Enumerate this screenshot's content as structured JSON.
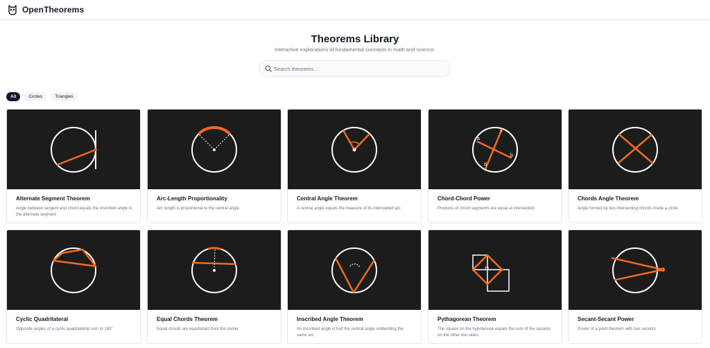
{
  "header": {
    "brand": "OpenTheorems",
    "logo_icon": "owl-icon"
  },
  "page": {
    "title": "Theorems Library",
    "subtitle": "Interactive explorations of fundamental concepts in math and science."
  },
  "search": {
    "placeholder": "Search theorems...",
    "value": ""
  },
  "filters": [
    {
      "label": "All",
      "active": true
    },
    {
      "label": "Circles",
      "active": false
    },
    {
      "label": "Triangles",
      "active": false
    }
  ],
  "colors": {
    "accent": "#f26b1d",
    "thumb_background": "#1c1c1c",
    "active_chip": "#0f172a"
  },
  "cards": [
    {
      "title": "Alternate Segment Theorem",
      "description": "Angle between tangent and chord equals the inscribed angle in the alternate segment"
    },
    {
      "title": "Arc-Length Proportionality",
      "description": "Arc length is proportional to the central angle"
    },
    {
      "title": "Central Angle Theorem",
      "description": "A central angle equals the measure of its intercepted arc"
    },
    {
      "title": "Chord-Chord Power",
      "description": "Products of chord segments are equal at intersection",
      "diagram_labels": [
        "a",
        "b",
        "c",
        "d"
      ]
    },
    {
      "title": "Chords Angle Theorem",
      "description": "Angle formed by two intersecting chords inside a circle"
    },
    {
      "title": "Cyclic Quadrilateral",
      "description": "Opposite angles of a cyclic quadrilateral sum to 180°"
    },
    {
      "title": "Equal Chords Theorem",
      "description": "Equal chords are equidistant from the center"
    },
    {
      "title": "Inscribed Angle Theorem",
      "description": "An inscribed angle is half the central angle subtending the same arc"
    },
    {
      "title": "Pythagorean Theorem",
      "description": "The square on the hypotenuse equals the sum of the squares on the other two sides."
    },
    {
      "title": "Secant-Secant Power",
      "description": "Power of a point theorem with two secants"
    }
  ]
}
